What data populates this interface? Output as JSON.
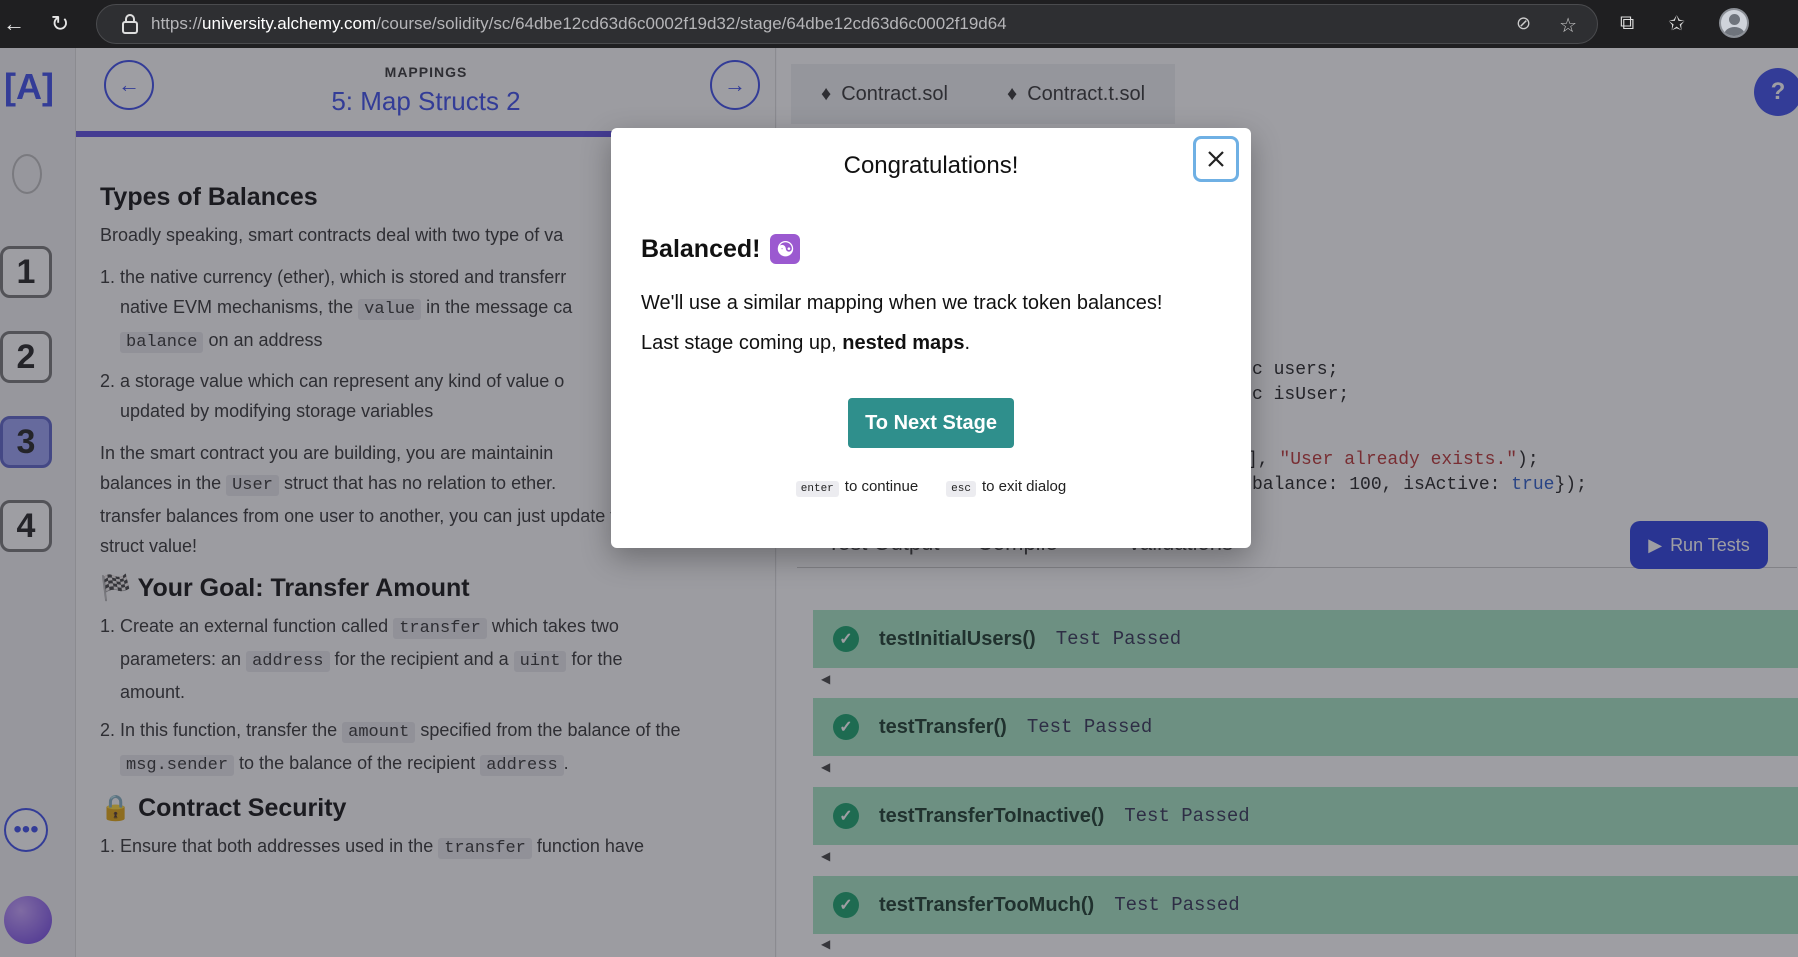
{
  "browser": {
    "url_prefix": "https://",
    "url_host": "university.alchemy.com",
    "url_path": "/course/solidity/sc/64dbe12cd63d6c0002f19d32/stage/64dbe12cd63d6c0002f19d64"
  },
  "sidebar": {
    "logo": "[A]",
    "steps": [
      "1",
      "2",
      "3",
      "4"
    ],
    "active_step": "3",
    "more_label": "•••"
  },
  "lesson": {
    "kicker": "MAPPINGS",
    "title": "5: Map Structs 2",
    "heading_balances": "Types of Balances",
    "p_intro": "Broadly speaking, smart contracts deal with two type of va",
    "li1_a": "the native currency (ether), which is stored and transferr",
    "li1_b": "native EVM mechanisms, the",
    "li1_code": "value",
    "li1_c": "in the message ca",
    "li1_code2": "balance",
    "li1_d": "on an address",
    "li2_a": "a storage value which can represent any kind of value o",
    "li2_b": "updated by modifying storage variables",
    "p2_a": "In the smart contract you are building, you are maintainin",
    "p2_b": "balances in the",
    "p2_code": "User",
    "p2_c": "struct that has no relation to ether.",
    "p2_d": "transfer balances from one user to another, you can just update the",
    "p2_e": "struct value!",
    "heading_goal": "🏁 Your Goal: Transfer Amount",
    "g1_a": "Create an external function called",
    "g1_code": "transfer",
    "g1_b": "which takes two",
    "g1_c": "parameters: an",
    "g1_code2": "address",
    "g1_d": "for the recipient and a",
    "g1_code3": "uint",
    "g1_e": "for the",
    "g1_f": "amount.",
    "g2_a": "In this function, transfer the",
    "g2_code": "amount",
    "g2_b": "specified from the balance of the",
    "g2_code2": "msg.sender",
    "g2_c": "to the balance of the recipient",
    "g2_code3": "address",
    "g2_d": ".",
    "heading_security": "🔒 Contract Security",
    "s1_a": "Ensure that both addresses used in the",
    "s1_code": "transfer",
    "s1_b": "function have"
  },
  "editor": {
    "tabs": [
      "Contract.sol",
      "Contract.t.sol"
    ],
    "help_label": "?",
    "code": {
      "l1": "c users;",
      "l2": "c isUser;",
      "l3a": "], ",
      "l3b": "\"User already exists.\"",
      "l3c": ");",
      "l4a": "balance: 100, isActive: ",
      "l4b": "true",
      "l4c": "});"
    },
    "result_tabs": [
      "Test Output",
      "Compile",
      "Validations"
    ],
    "run_label": "Run Tests",
    "tests": [
      {
        "name": "testInitialUsers()",
        "status": "Test Passed"
      },
      {
        "name": "testTransfer()",
        "status": "Test Passed"
      },
      {
        "name": "testTransferToInactive()",
        "status": "Test Passed"
      },
      {
        "name": "testTransferTooMuch()",
        "status": "Test Passed"
      }
    ]
  },
  "dialog": {
    "title": "Congratulations!",
    "heading": "Balanced!",
    "heading_emoji": "☯",
    "text1": "We'll use a similar mapping when we track token balances!",
    "text2_a": "Last stage coming up, ",
    "text2_bold": "nested maps",
    "text2_b": ".",
    "button": "To Next Stage",
    "hint_enter_key": "enter",
    "hint_enter_text": "to continue",
    "hint_esc_key": "esc",
    "hint_esc_text": "to exit dialog"
  }
}
